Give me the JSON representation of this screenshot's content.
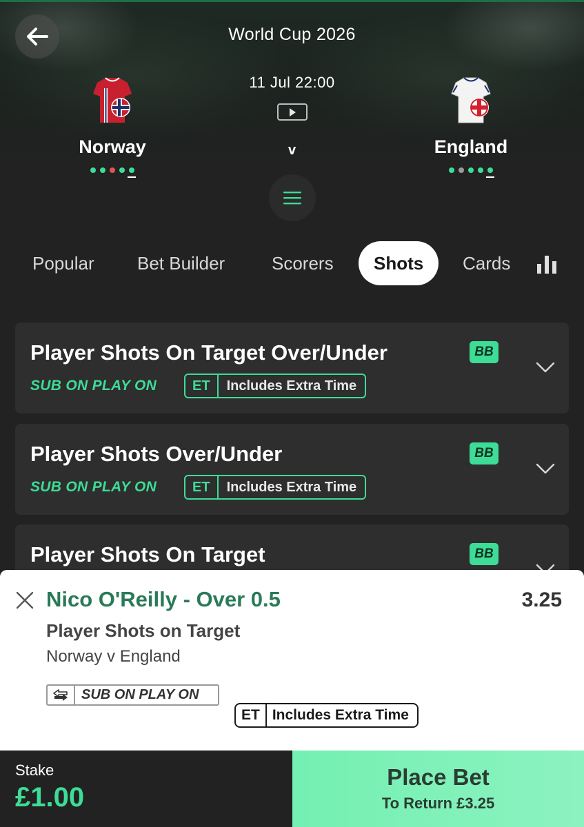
{
  "header": {
    "title": "World Cup 2026",
    "kickoff": "11 Jul 22:00",
    "vs": "v",
    "home_team": {
      "name": "Norway",
      "form": [
        "#3ddc97",
        "#3ddc97",
        "#e05555",
        "#3ddc97",
        "#3ddc97"
      ]
    },
    "away_team": {
      "name": "England",
      "form": [
        "#3ddc97",
        "#9a9a9a",
        "#3ddc97",
        "#3ddc97",
        "#3ddc97"
      ]
    }
  },
  "tabs": [
    {
      "label": "Popular",
      "active": false
    },
    {
      "label": "Bet Builder",
      "active": false
    },
    {
      "label": "Scorers",
      "active": false
    },
    {
      "label": "Shots",
      "active": true
    },
    {
      "label": "Cards",
      "active": false
    }
  ],
  "markets": [
    {
      "title": "Player Shots On Target Over/Under",
      "sub_label": "SUB ON PLAY ON",
      "et": "ET",
      "et_text": "Includes Extra Time",
      "bb": "BB"
    },
    {
      "title": "Player Shots Over/Under",
      "sub_label": "SUB ON PLAY ON",
      "et": "ET",
      "et_text": "Includes Extra Time",
      "bb": "BB"
    },
    {
      "title": "Player Shots On Target",
      "bb": "BB"
    }
  ],
  "betslip": {
    "selection": "Nico O'Reilly - Over 0.5",
    "odds": "3.25",
    "market": "Player Shots on Target",
    "event": "Norway v England",
    "sub_badge": "SUB ON PLAY ON",
    "et": "ET",
    "et_text": "Includes Extra Time"
  },
  "footer": {
    "stake_label": "Stake",
    "stake_value": "£1.00",
    "place_bet_label": "Place Bet",
    "return_text": "To Return £3.25"
  },
  "colors": {
    "accent": "#3ddc97",
    "selection_green": "#2a7a58",
    "background": "#222222",
    "card": "#2e2e2e"
  },
  "icons": [
    "back-arrow-icon",
    "play-icon",
    "menu-icon",
    "stats-icon",
    "chevron-down-icon",
    "close-icon",
    "swap-icon"
  ]
}
